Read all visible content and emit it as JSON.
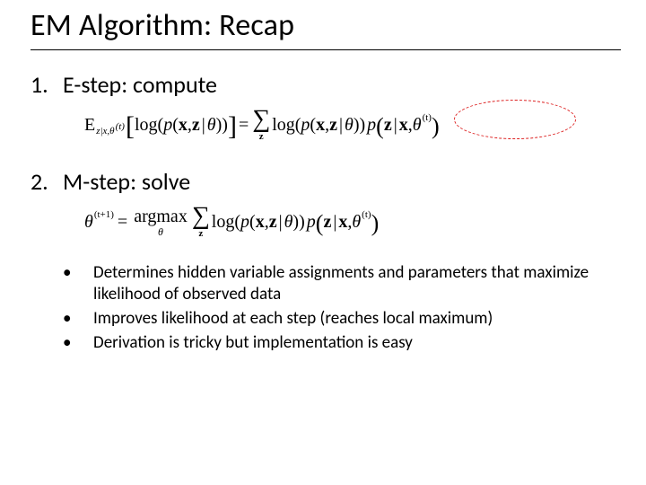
{
  "title": "EM Algorithm: Recap",
  "steps": [
    {
      "num": "1.",
      "label": "E-step: compute"
    },
    {
      "num": "2.",
      "label": "M-step: solve"
    }
  ],
  "formula1": {
    "E": "E",
    "E_sub": "z|x,θ",
    "E_sub_sup": "(t)",
    "lbrack": "[",
    "log": "log",
    "p": "p",
    "lp": "(",
    "x": "x",
    "comma": ",",
    "z": "z",
    "bar": " | ",
    "theta": "θ",
    "rp": ")",
    "rbrack": "]",
    "eq": "=",
    "sum_below": "z",
    "p2": "p",
    "z2": "z",
    "x2": "x",
    "theta_t": "θ",
    "t_sup": "(t)"
  },
  "formula2": {
    "theta": "θ",
    "t1_sup": "(t+1)",
    "eq": "=",
    "argmax": "argmax",
    "argmax_below": "θ",
    "sum_below": "z",
    "log": "log",
    "p": "p",
    "lp": "(",
    "x": "x",
    "comma": ",",
    "z": "z",
    "bar": " | ",
    "rp": ")",
    "p2": "p",
    "t_sup": "(t)"
  },
  "bullets": [
    "Determines hidden variable assignments and parameters that maximize likelihood of observed data",
    "Improves likelihood at each step (reaches local maximum)",
    "Derivation is tricky but implementation is easy"
  ]
}
